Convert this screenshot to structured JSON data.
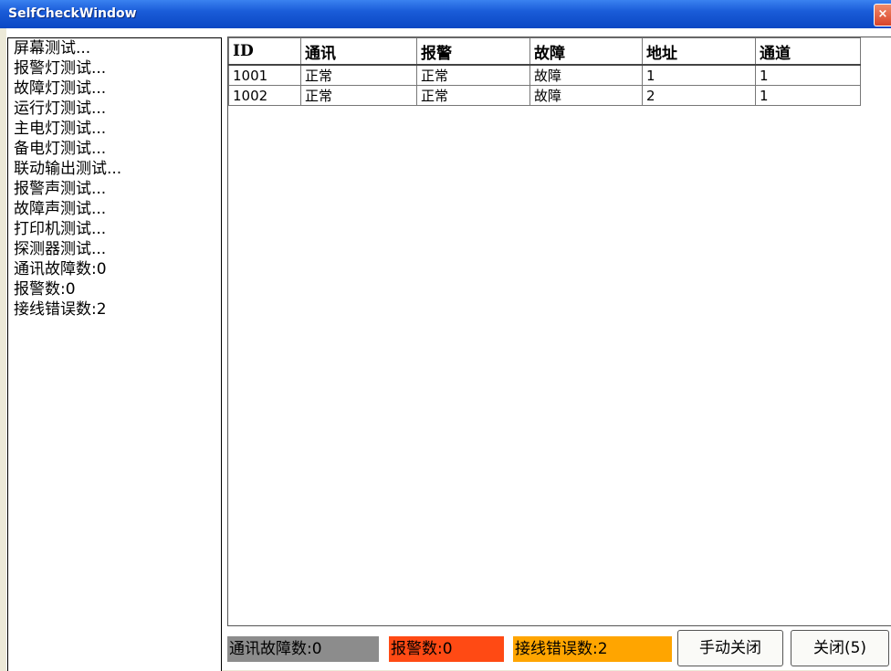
{
  "window": {
    "title": "SelfCheckWindow",
    "close_glyph": "×"
  },
  "left_panel": {
    "items": [
      "屏幕测试...",
      "报警灯测试...",
      "故障灯测试...",
      "运行灯测试...",
      "主电灯测试...",
      "备电灯测试...",
      "联动输出测试...",
      "报警声测试...",
      "故障声测试...",
      "打印机测试...",
      "探测器测试...",
      "通讯故障数:0",
      "报警数:0",
      "接线错误数:2"
    ]
  },
  "table": {
    "headers": [
      "ID",
      "通讯",
      "报警",
      "故障",
      "地址",
      "通道"
    ],
    "rows": [
      [
        "1001",
        "正常",
        "正常",
        "故障",
        "1",
        "1"
      ],
      [
        "1002",
        "正常",
        "正常",
        "故障",
        "2",
        "1"
      ]
    ]
  },
  "status_bar": {
    "comm_fault": "通讯故障数:0",
    "alarm": "报警数:0",
    "wiring_error": "接线错误数:2"
  },
  "buttons": {
    "manual_close": "手动关闭",
    "close": "关闭(5)"
  },
  "colors": {
    "titlebar": "#0b47c4",
    "comm_fault_bg": "#8c8c8c",
    "alarm_bg": "#ff4a14",
    "wiring_error_bg": "#ffa500"
  },
  "icons": {
    "close": "close-icon"
  }
}
